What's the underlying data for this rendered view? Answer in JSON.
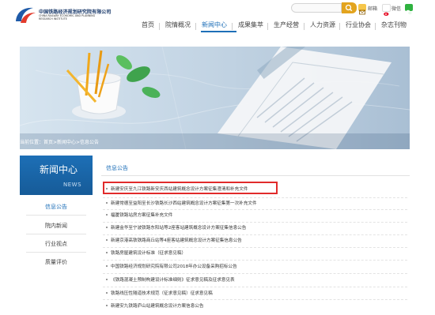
{
  "header": {
    "logo_cn": "中国铁路经济规划研究院有限公司",
    "logo_en": "CHINA RAILWAY ECONOMIC AND PLANNING\nRESEARCH INSTITUTE",
    "search_placeholder": "",
    "links": [
      "邮箱",
      "微信"
    ]
  },
  "nav": {
    "items": [
      "首页",
      "院情概况",
      "新闻中心",
      "成果集萃",
      "生产经营",
      "人力资源",
      "行业协会",
      "杂志刊物"
    ],
    "active_index": 2
  },
  "banner": {
    "breadcrumb": "当前位置：首页>新闻中心>信息公告"
  },
  "sidebar": {
    "title": "新闻中心",
    "subtitle": "NEWS",
    "items": [
      "信息公告",
      "院内新闻",
      "行业视点",
      "质量评价"
    ],
    "active_index": 0
  },
  "content": {
    "category": "信息公告",
    "articles": [
      "新建安庆至九江铁路新安庆西站建筑概念设计方案征集澄清和补充文件",
      "新建常德至益阳至长沙铁路长沙西站建筑概念设计方案征集第一次补充文件",
      "福厦铁路站房方案征集补充文件",
      "新建金华至宁波铁路东阳站等2座客站建筑概念设计方案征集信息公告",
      "新建京港高铁铁路商丘站等4座客站建筑概念设计方案征集信息公告",
      "铁路房屋建筑设计标准（征求意见稿）",
      "中国铁路经济规划研究院有限公司2018年办公设备采购招标公告",
      "《铁路混凝土预制构建设计标准细则》征求意见稿及征求意见表",
      "铁路线压性隧道技术规范（征求意见稿）征求意见稿",
      "新建安九铁路庐山站建筑概念设计方案信息公告"
    ],
    "highlighted_index": 0
  },
  "colors": {
    "accent": "#1e6fb8",
    "search_button": "#e3a41e",
    "highlight_border": "#e12b2b"
  }
}
